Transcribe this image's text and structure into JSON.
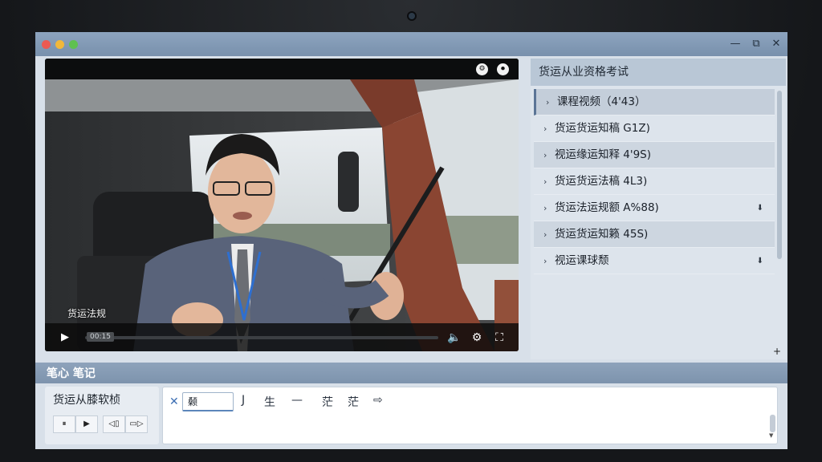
{
  "window": {
    "controls": {
      "minimize": "—",
      "maximize": "⧉",
      "close": "✕"
    }
  },
  "video": {
    "top_icons": [
      "⚙",
      "⏺"
    ],
    "caption": "货运法规",
    "time": "00:15",
    "progress": 0.0
  },
  "sidebar": {
    "title": "货运从业资格考试",
    "items": [
      {
        "label": "课程视频（4'43）",
        "download": ""
      },
      {
        "label": "货运货运知稿 G1Z)",
        "download": ""
      },
      {
        "label": "视运缘运知释 4'9S)",
        "download": ""
      },
      {
        "label": "货运货运法稿 4L3)",
        "download": ""
      },
      {
        "label": "货运法运规额 A%88)",
        "download": "⬇"
      },
      {
        "label": "货运货运知籁 45S)",
        "download": ""
      },
      {
        "label": "视运课球颓",
        "download": "⬇"
      }
    ],
    "add": "+"
  },
  "notes": {
    "title": "笔心 笔记",
    "left_title": "货运从膝软桢",
    "buttons": [
      "⏸",
      "▶",
      "◁▯",
      "▭▷"
    ],
    "editor": {
      "close": "✕",
      "input_value": "颡",
      "tools": [
        "J",
        "生",
        "—",
        "茫",
        "茫",
        "⇨"
      ]
    }
  },
  "colors": {
    "accent": "#5b7596",
    "titlebar": "#8da4bf"
  }
}
